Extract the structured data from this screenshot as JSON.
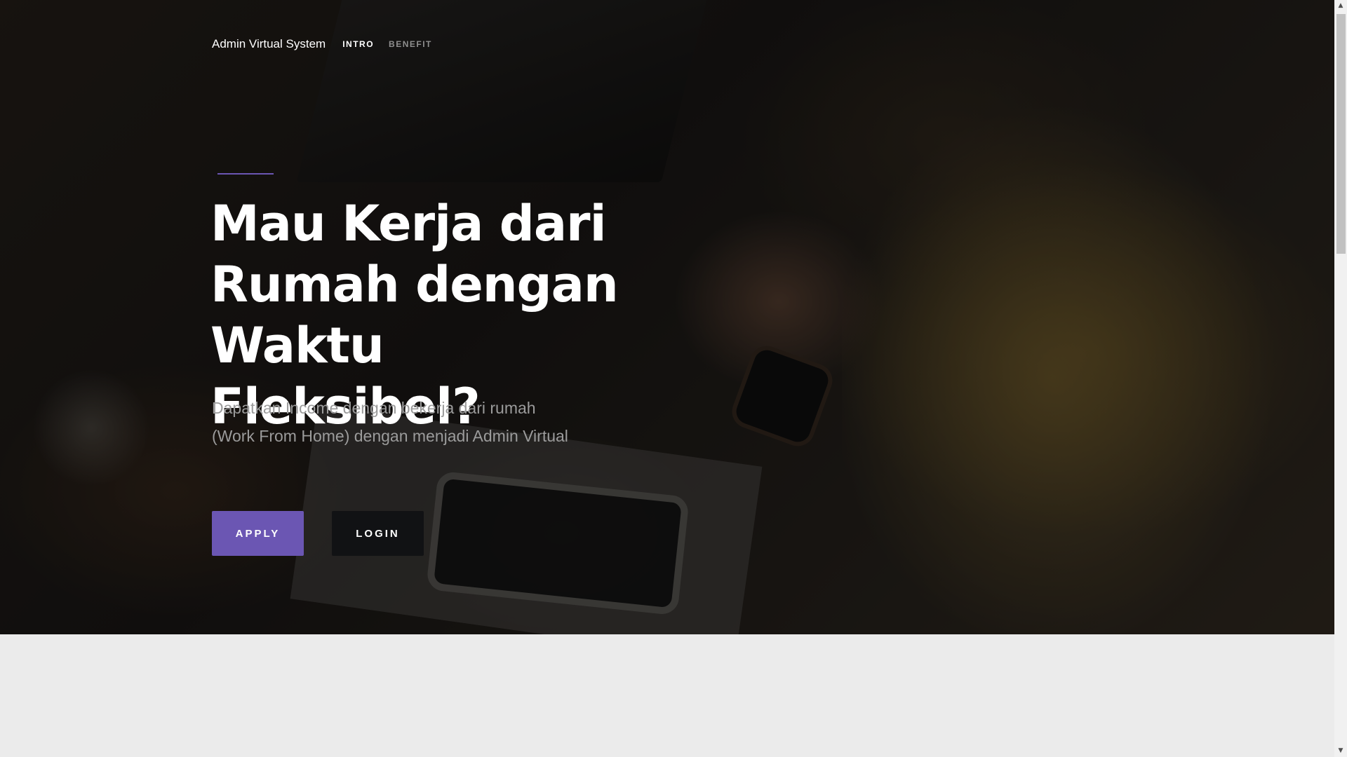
{
  "nav": {
    "brand": "Admin Virtual System",
    "links": [
      {
        "label": "INTRO",
        "state": "active"
      },
      {
        "label": "BENEFIT",
        "state": "inactive"
      }
    ]
  },
  "hero": {
    "headline_lines": [
      "Mau Kerja dari",
      "Rumah dengan",
      "Waktu Fleksibel?"
    ],
    "subtitle_lines": [
      "Dapatkan Income dengan bekerja dari rumah",
      "(Work From Home) dengan menjadi Admin Virtual"
    ],
    "buttons": {
      "apply": "APPLY",
      "login": "LOGIN"
    }
  },
  "scrollbar": {
    "up_icon": "triangle-up",
    "down_icon": "triangle-down"
  },
  "colors": {
    "accent": "#6b56b3",
    "login_button": "#111214",
    "page_background": "#ebebeb"
  }
}
